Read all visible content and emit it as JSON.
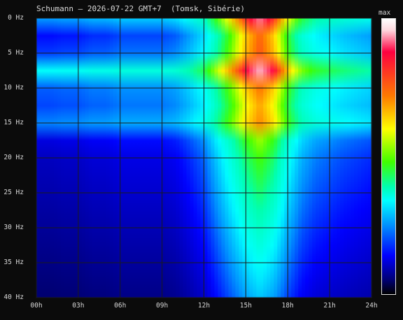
{
  "chart_data": {
    "type": "heatmap",
    "title": "Schumann – 2026-07-22 GMT+7  (Tomsk, Sibérie)",
    "x_tick_labels": [
      "00h",
      "03h",
      "06h",
      "09h",
      "12h",
      "15h",
      "18h",
      "21h",
      "24h"
    ],
    "y_tick_labels": [
      "0 Hz",
      "5 Hz",
      "10 Hz",
      "15 Hz",
      "20 Hz",
      "25 Hz",
      "30 Hz",
      "35 Hz",
      "40 Hz"
    ],
    "x_range_hours": [
      0,
      24
    ],
    "y_range_hz": [
      0,
      40
    ],
    "colorbar_label": "max",
    "colormap": [
      "#000000",
      "#000080",
      "#0000ff",
      "#0090ff",
      "#00ffff",
      "#00ffb0",
      "#40ff00",
      "#ffff00",
      "#ff7a00",
      "#ff0040",
      "#ffffff"
    ],
    "grid": true,
    "grid_color": "#1a1a1a",
    "intensity_profile": {
      "hours": [
        0,
        1,
        2,
        3,
        4,
        5,
        6,
        7,
        8,
        9,
        10,
        11,
        12,
        13,
        14,
        15,
        16,
        17,
        18,
        19,
        20,
        21,
        22,
        23,
        24
      ],
      "relative_level": [
        0.25,
        0.25,
        0.26,
        0.26,
        0.28,
        0.28,
        0.3,
        0.3,
        0.3,
        0.3,
        0.32,
        0.38,
        0.45,
        0.6,
        0.75,
        0.9,
        1.0,
        0.9,
        0.7,
        0.55,
        0.48,
        0.45,
        0.42,
        0.4,
        0.38
      ]
    },
    "peaks_hz": [
      7.8,
      14.3
    ]
  }
}
